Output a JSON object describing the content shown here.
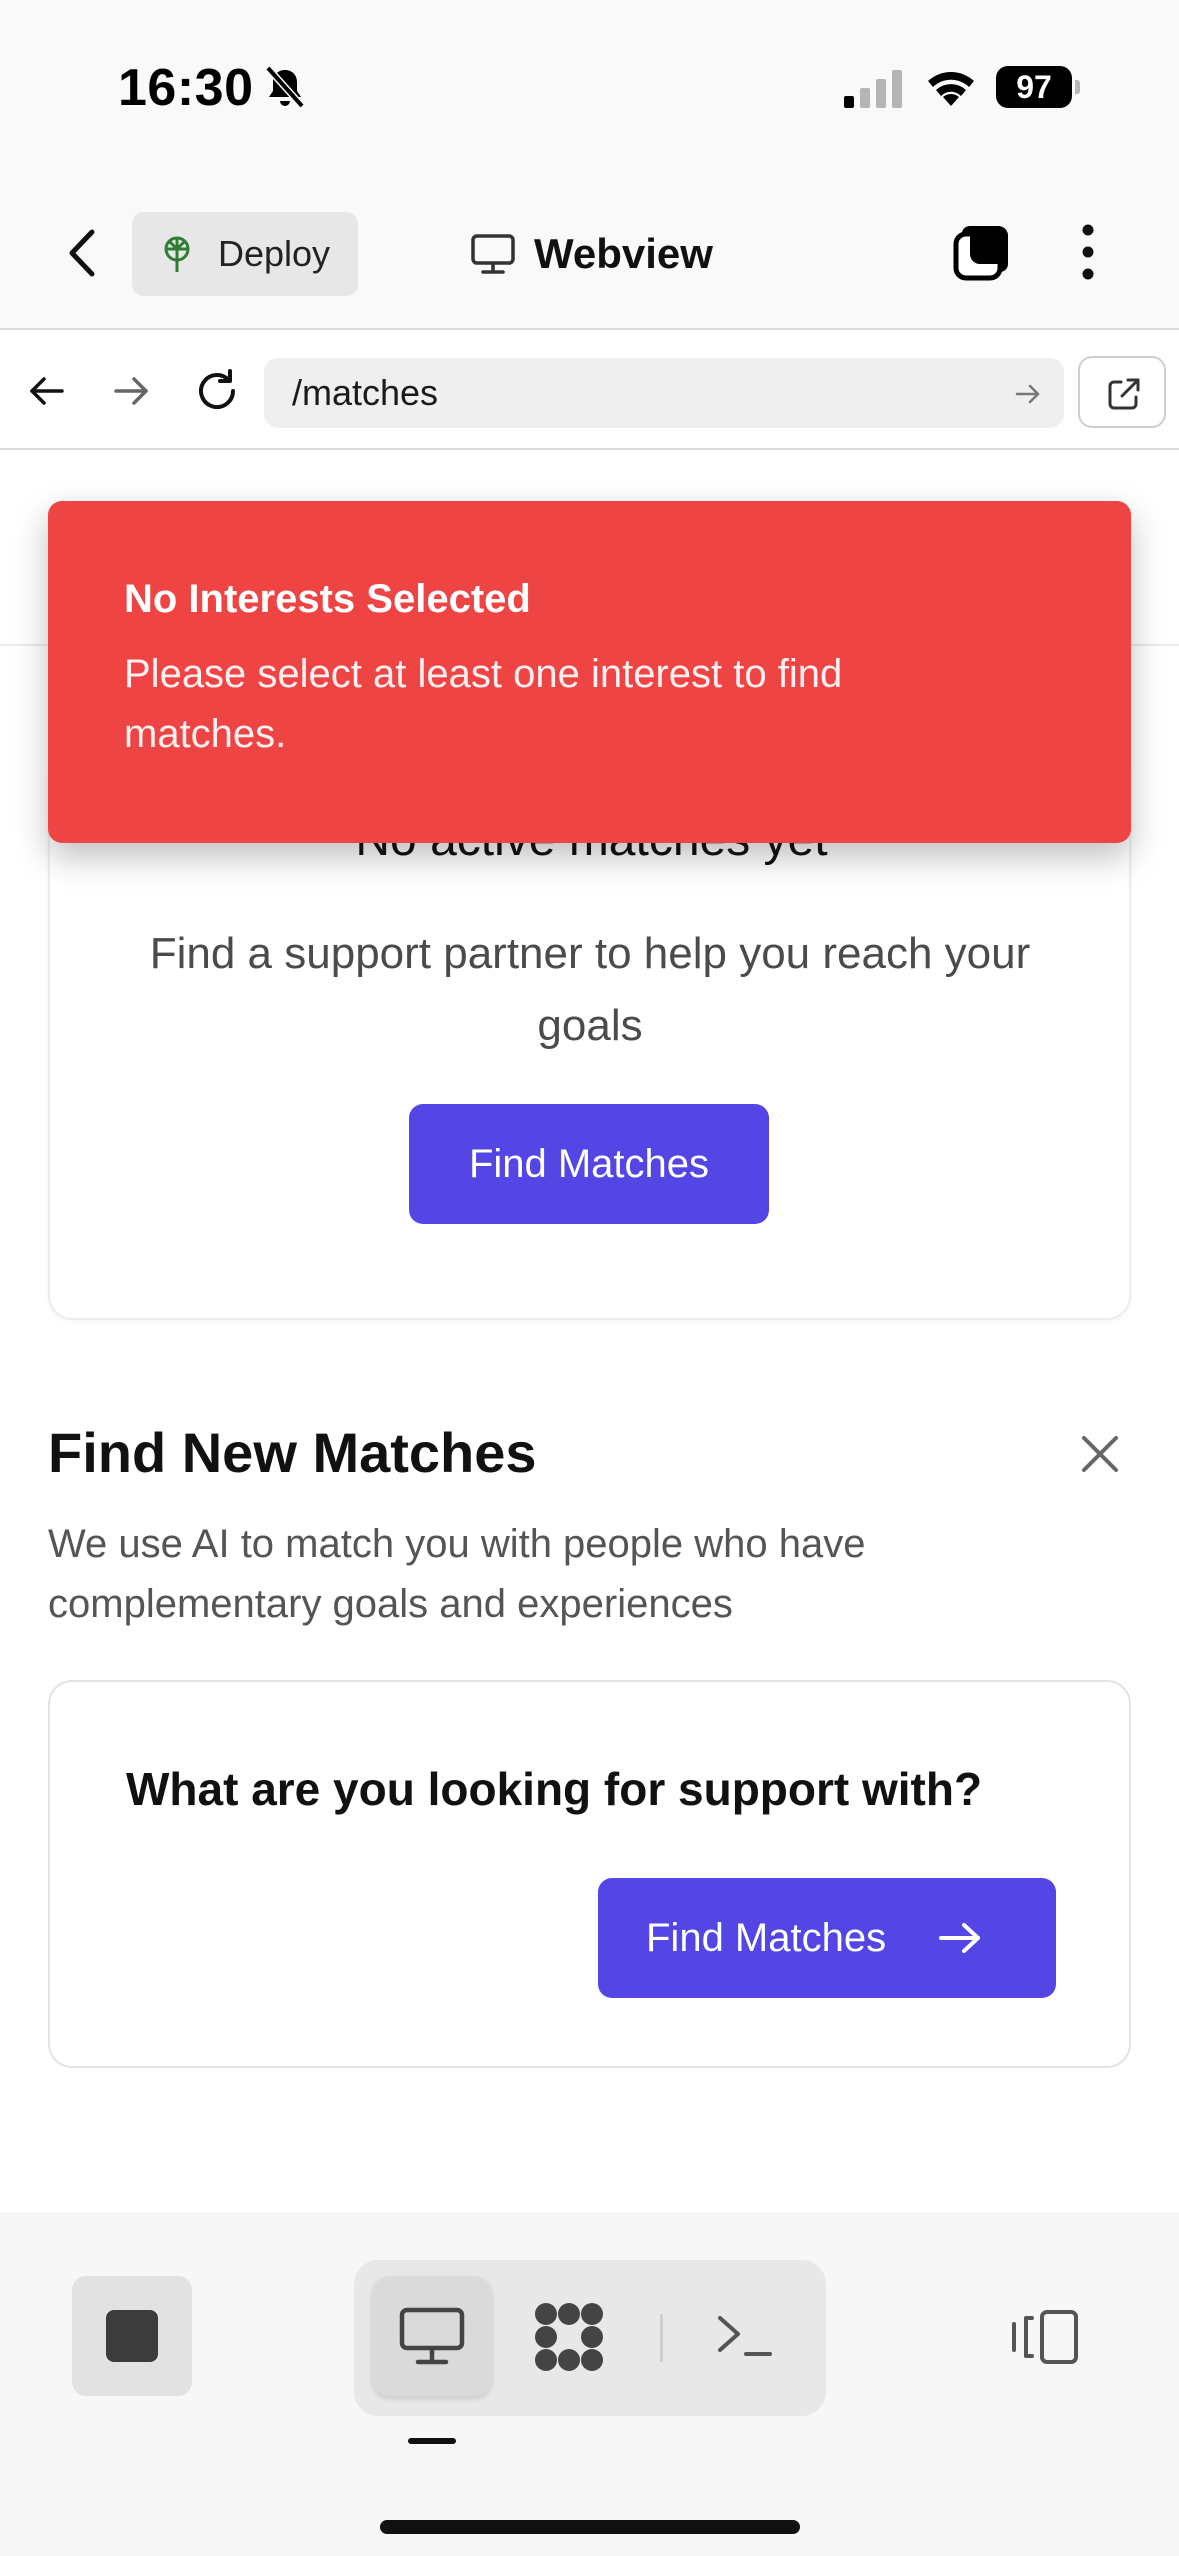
{
  "status_bar": {
    "time": "16:30",
    "battery": "97",
    "icons": [
      "bell-slash-icon",
      "cellular-signal-icon",
      "wifi-icon",
      "battery-icon"
    ]
  },
  "header": {
    "deploy_label": "Deploy",
    "title": "Webview",
    "icons": [
      "chevron-left-icon",
      "deploy-icon",
      "monitor-icon",
      "tabs-icon",
      "more-vertical-icon"
    ]
  },
  "browser": {
    "url": "/matches",
    "icons": [
      "arrow-left-icon",
      "arrow-right-icon",
      "reload-icon",
      "arrow-right-small-icon",
      "external-link-icon"
    ]
  },
  "toast": {
    "title": "No Interests Selected",
    "message": "Please select at least one interest to find matches.",
    "color": "#ef4444"
  },
  "active_matches": {
    "title": "No active matches yet",
    "subtitle": "Find a support partner to help you reach your goals",
    "button_label": "Find Matches"
  },
  "find_new": {
    "title": "Find New Matches",
    "description": "We use AI to match you with people who have complementary goals and experiences",
    "question": "What are you looking for support with?",
    "button_label": "Find Matches"
  },
  "toolbar": {
    "icons": [
      "stop-icon",
      "desktop-icon",
      "apps-icon",
      "console-icon",
      "panel-toggle-icon"
    ]
  },
  "colors": {
    "accent": "#5346e5",
    "toast": "#ef4444"
  }
}
